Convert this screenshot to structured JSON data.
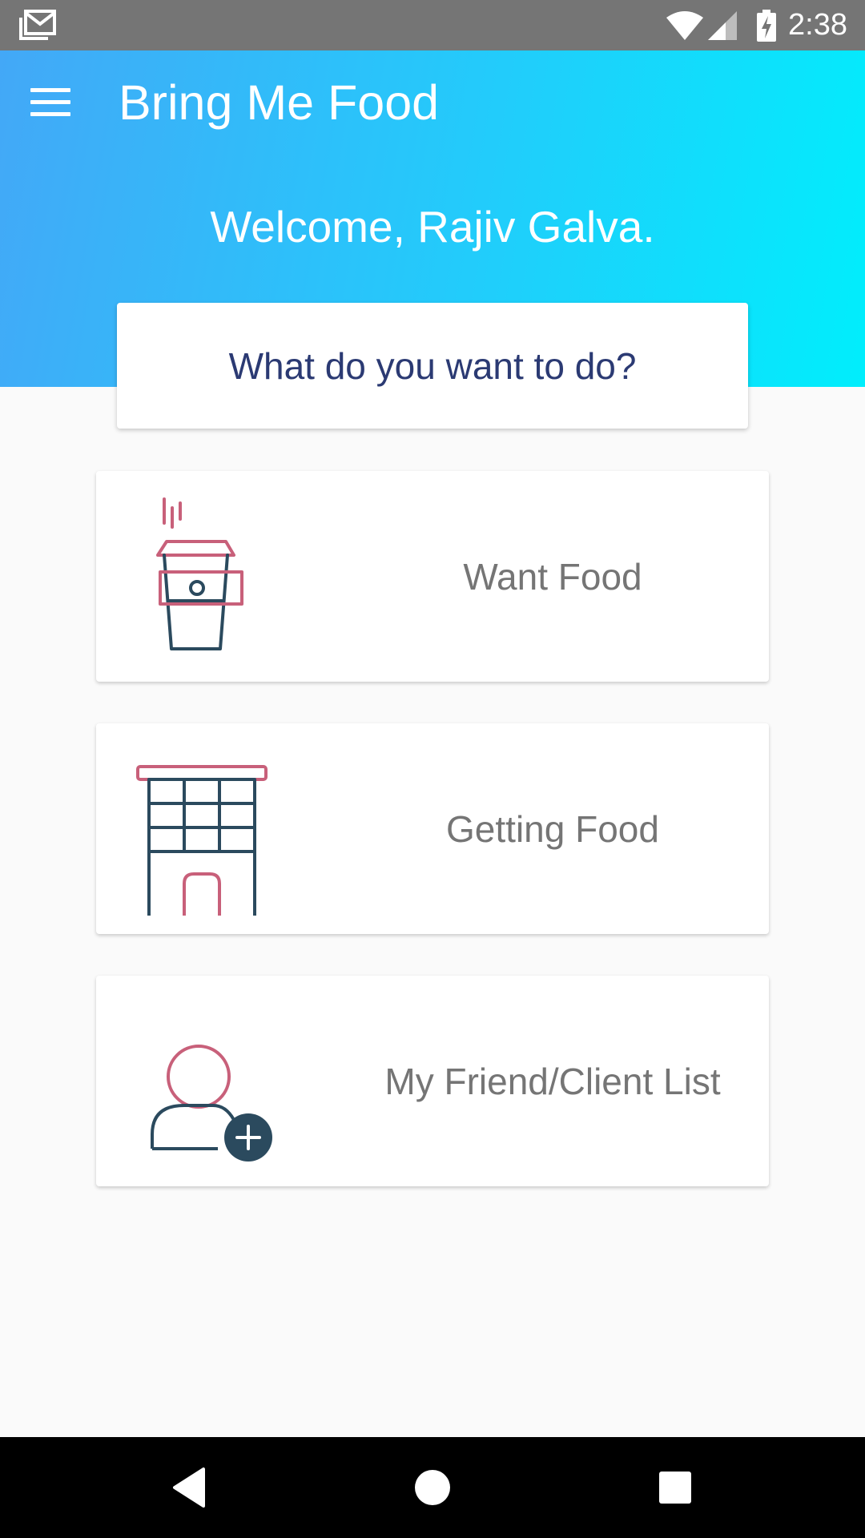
{
  "status_bar": {
    "time": "2:38",
    "icons": [
      "gmail-icon",
      "wifi-icon",
      "signal-icon",
      "battery-charging-icon"
    ]
  },
  "header": {
    "menu_icon": "hamburger-menu-icon",
    "title": "Bring Me Food",
    "welcome": "Welcome, Rajiv Galva."
  },
  "prompt": {
    "text": "What do you want to do?"
  },
  "options": [
    {
      "label": "Want Food",
      "icon": "coffee-cup-icon"
    },
    {
      "label": "Getting Food",
      "icon": "building-icon"
    },
    {
      "label": "My Friend/Client List",
      "icon": "add-user-icon"
    }
  ],
  "nav_bar": {
    "buttons": [
      "back-icon",
      "home-icon",
      "recents-icon"
    ]
  },
  "colors": {
    "header_gradient_start": "#43a8f7",
    "header_gradient_end": "#00eefc",
    "icon_pink": "#c8607a",
    "icon_navy": "#2b4a5e",
    "prompt_text": "#2b3a73",
    "option_text": "#757575"
  }
}
